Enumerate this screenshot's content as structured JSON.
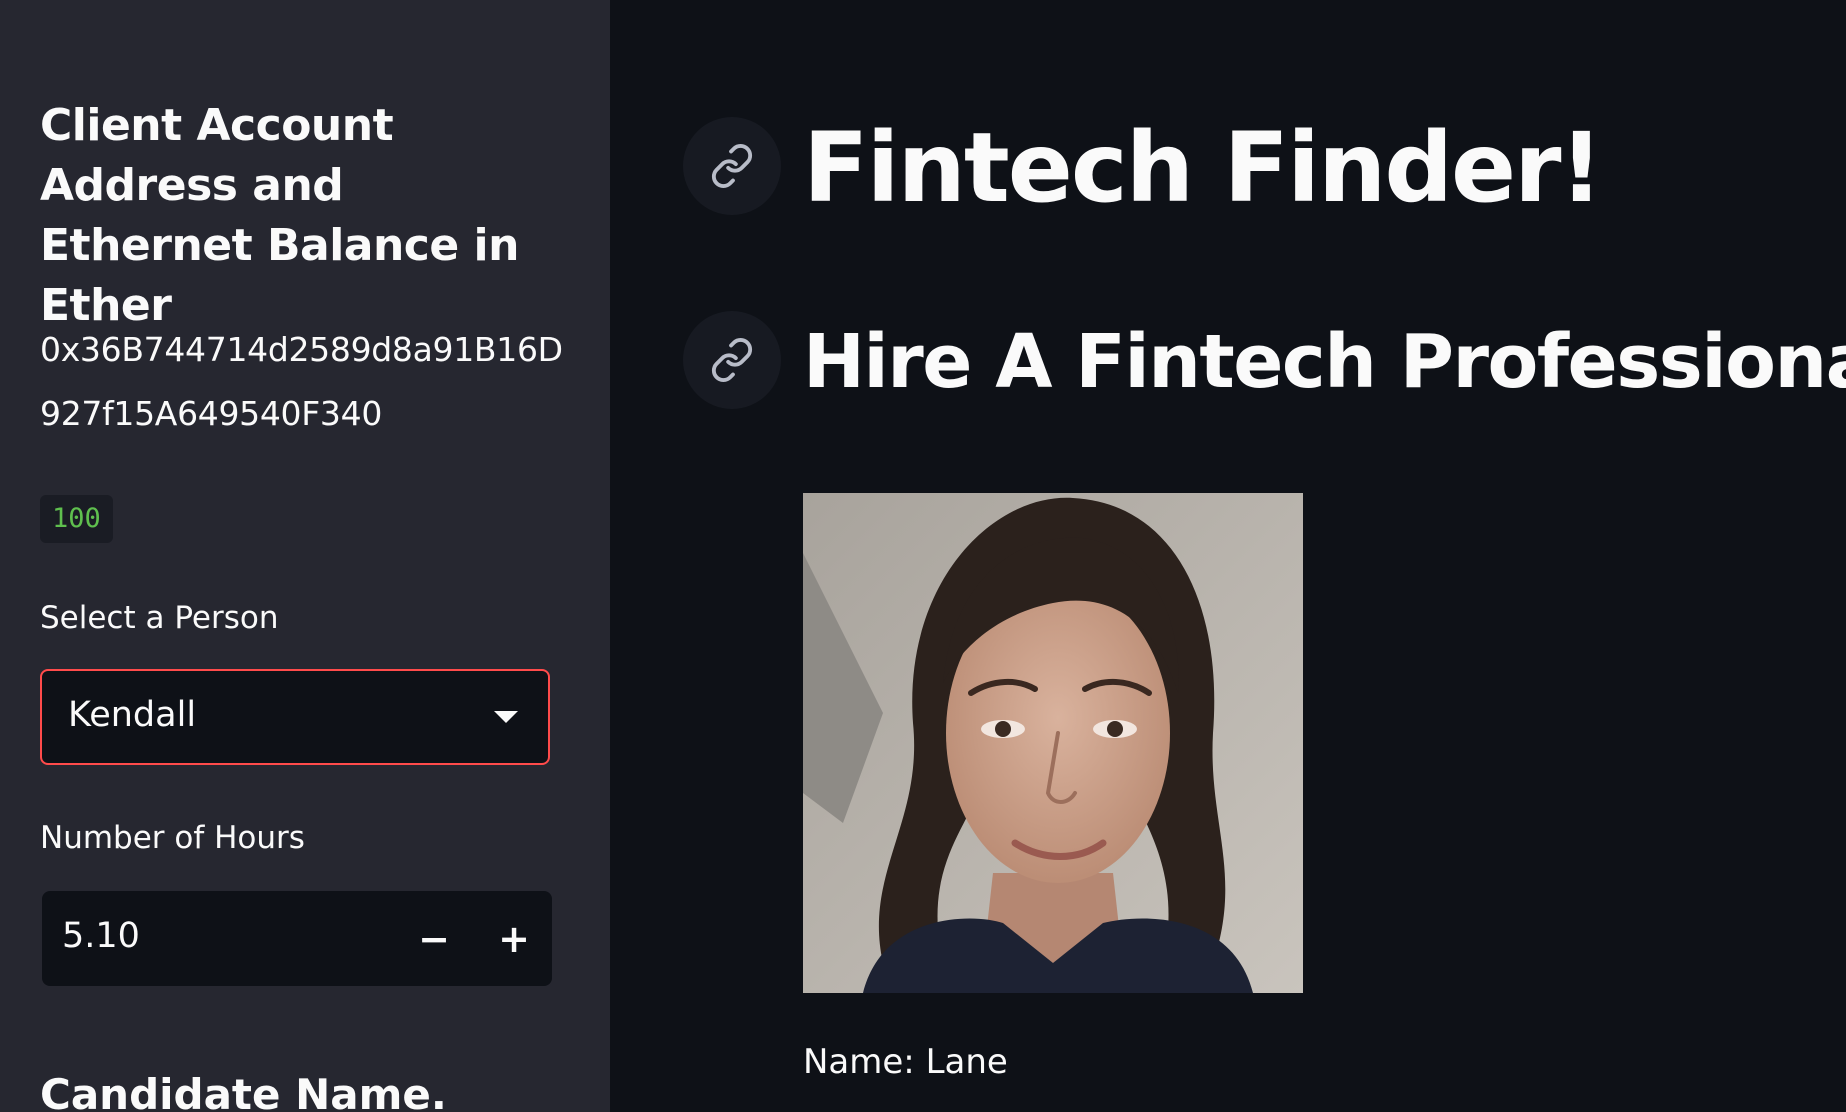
{
  "sidebar": {
    "title": "Client Account Address and Ethernet Balance in Ether",
    "address": "0x36B744714d2589d8a91B16D927f15A649540F340",
    "balance": "100",
    "select_label": "Select a Person",
    "select_value": "Kendall",
    "hours_label": "Number of Hours",
    "hours_value": "5.10",
    "decrement": "−",
    "increment": "+",
    "subheader": "Candidate Name."
  },
  "main": {
    "title": "Fintech Finder!",
    "subtitle": "Hire A Fintech Professional!",
    "candidate_name_line": "Name: Lane"
  },
  "colors": {
    "sidebar_bg": "#262730",
    "main_bg": "#0e1117",
    "accent": "#ff4b4b",
    "code_green": "#5fbf4e"
  },
  "icons": {
    "anchor": "link-icon",
    "dropdown": "chevron-down-icon"
  }
}
